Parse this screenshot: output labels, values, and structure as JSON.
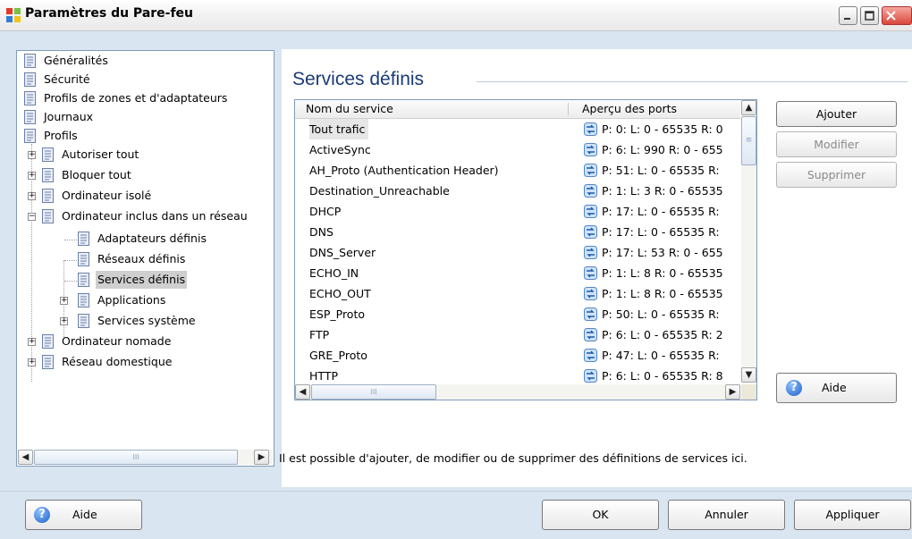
{
  "window": {
    "title": "Paramètres du Pare-feu",
    "controls": [
      "minimize",
      "maximize",
      "close"
    ]
  },
  "tree": {
    "items": [
      {
        "label": "Généralités"
      },
      {
        "label": "Sécurité"
      },
      {
        "label": "Profils de zones et d'adaptateurs"
      },
      {
        "label": "Journaux"
      },
      {
        "label": "Profils"
      },
      {
        "label": "Autoriser tout"
      },
      {
        "label": "Bloquer tout"
      },
      {
        "label": "Ordinateur isolé"
      },
      {
        "label": "Ordinateur inclus dans un réseau"
      },
      {
        "label": "Adaptateurs définis"
      },
      {
        "label": "Réseaux définis"
      },
      {
        "label": "Services définis"
      },
      {
        "label": "Applications"
      },
      {
        "label": "Services système"
      },
      {
        "label": "Ordinateur nomade"
      },
      {
        "label": "Réseau domestique"
      }
    ],
    "selected": "Services définis",
    "scroll_thumb_glyph": "III"
  },
  "content": {
    "title": "Services définis",
    "columns": [
      "Nom du service",
      "Aperçu des ports"
    ],
    "rows": [
      {
        "name": "Tout trafic",
        "ports": "P: 0:  L: 0 - 65535 R: 0"
      },
      {
        "name": "ActiveSync",
        "ports": "P: 6:  L: 990 R: 0 - 655"
      },
      {
        "name": "AH_Proto (Authentication Header)",
        "ports": "P: 51:  L: 0 - 65535 R:"
      },
      {
        "name": "Destination_Unreachable",
        "ports": "P: 1:  L: 3 R: 0 - 65535"
      },
      {
        "name": "DHCP",
        "ports": "P: 17:  L: 0 - 65535 R:"
      },
      {
        "name": "DNS",
        "ports": "P: 17:  L: 0 - 65535 R:"
      },
      {
        "name": "DNS_Server",
        "ports": "P: 17:  L: 53 R: 0 - 655"
      },
      {
        "name": "ECHO_IN",
        "ports": "P: 1:  L: 8 R: 0 - 65535"
      },
      {
        "name": "ECHO_OUT",
        "ports": "P: 1:  L: 8 R: 0 - 65535"
      },
      {
        "name": "ESP_Proto",
        "ports": "P: 50:  L: 0 - 65535 R:"
      },
      {
        "name": "FTP",
        "ports": "P: 6:  L: 0 - 65535 R: 2"
      },
      {
        "name": "GRE_Proto",
        "ports": "P: 47:  L: 0 - 65535 R:"
      },
      {
        "name": "HTTP",
        "ports": "P: 6:  L: 0 - 65535 R: 8"
      }
    ],
    "selected_row": "Tout trafic",
    "buttons": {
      "add": "Ajouter",
      "edit": "Modifier",
      "delete": "Supprimer",
      "help": "Aide"
    },
    "description": "Il est possible d'ajouter, de modifier ou de supprimer des définitions de services ici."
  },
  "footer": {
    "help": "Aide",
    "ok": "OK",
    "cancel": "Annuler",
    "apply": "Appliquer"
  },
  "colors": {
    "title_blue": "#1a3b78",
    "panel_bg": "#d9e5f1",
    "selection_gray": "#cfcfcf"
  }
}
